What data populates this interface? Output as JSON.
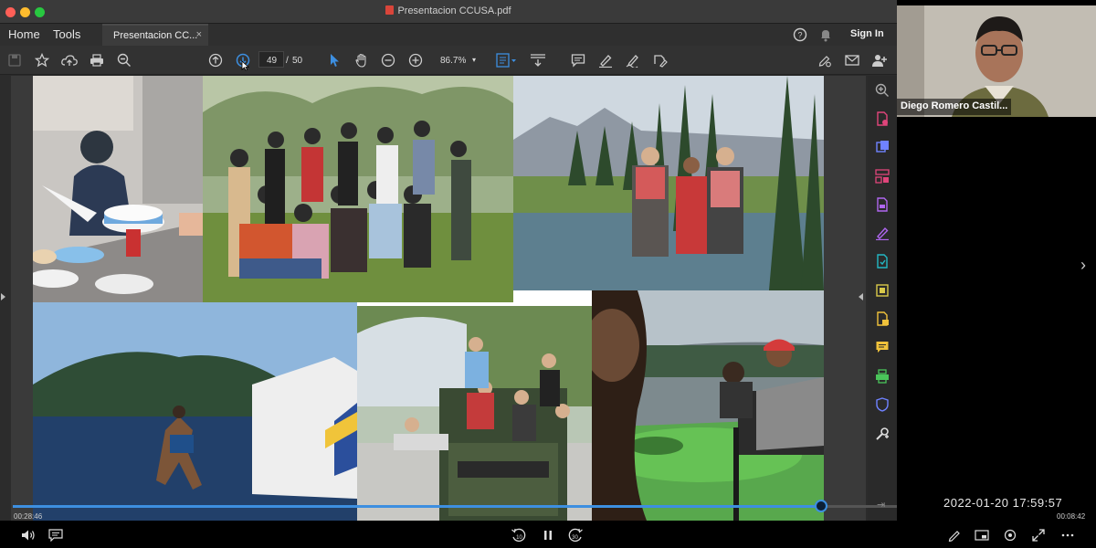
{
  "window": {
    "title": "Presentacion CCUSA.pdf",
    "menu": [
      "Home",
      "Tools"
    ],
    "tab_label": "Presentacion CC...",
    "tab_close": "×",
    "sign_in": "Sign In"
  },
  "toolbar": {
    "current_page": "49",
    "page_separator": "/",
    "total_pages": "50",
    "zoom": "86.7%",
    "zoom_caret": "▾"
  },
  "participant": {
    "name": "Diego Romero Castil..."
  },
  "video": {
    "timestamp": "2022-01-20  17:59:57",
    "elapsed": "00:28:46",
    "remaining": "00:08:42",
    "progress_fraction": 0.914
  },
  "player_controls": {
    "rewind_seconds": "10",
    "forward_seconds": "30"
  },
  "colors": {
    "accent": "#3d8fe0",
    "right_rail_icons": [
      "#aaaaaa",
      "#e0457b",
      "#6f82ff",
      "#e0457b",
      "#b066f0",
      "#b066f0",
      "#23b8c4",
      "#d9c94a",
      "#f0c23b",
      "#f0c23b",
      "#4ac45a",
      "#6f82ff",
      "#dddddd"
    ]
  }
}
